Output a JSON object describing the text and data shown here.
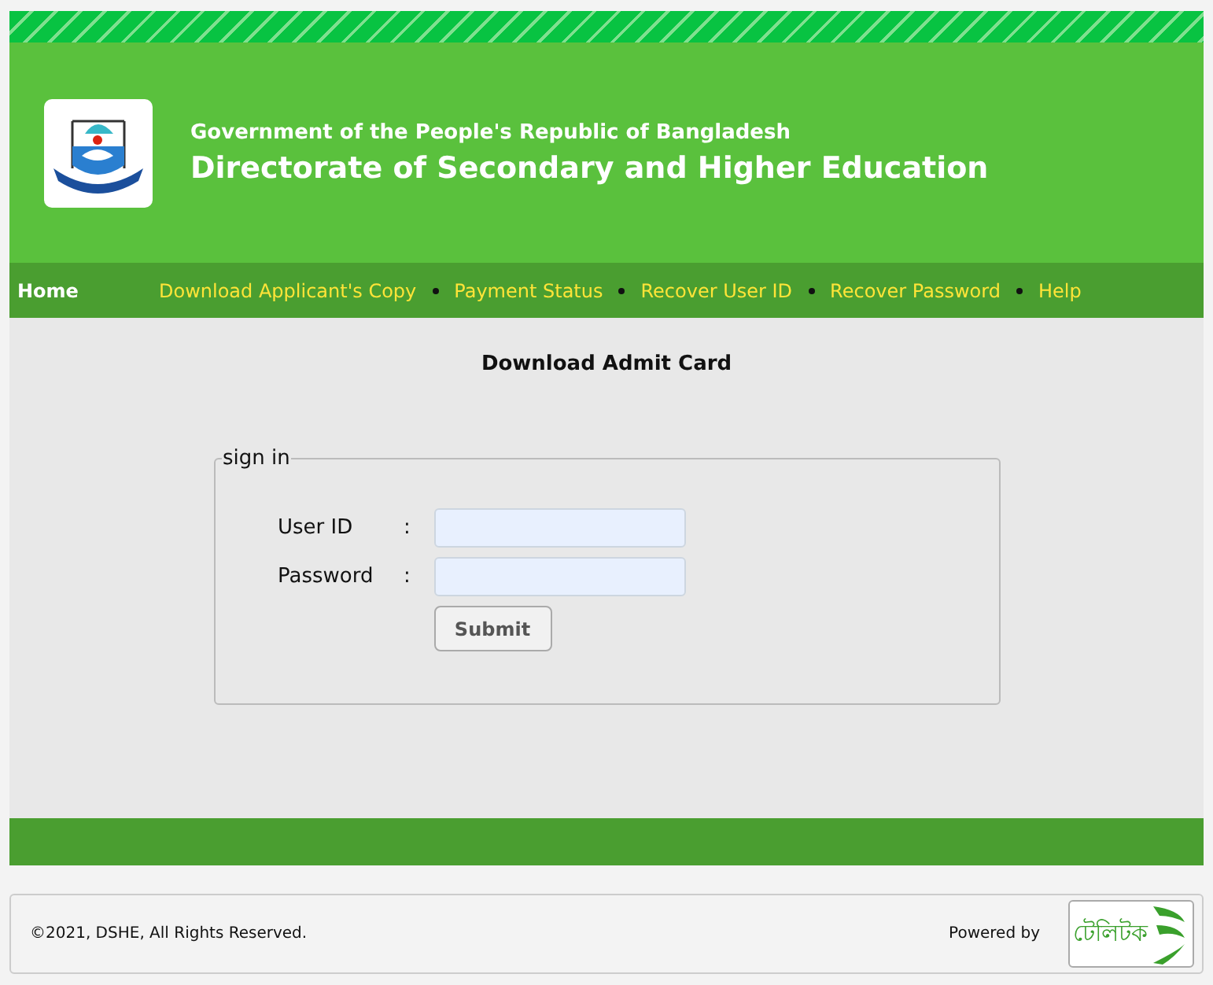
{
  "header": {
    "subtitle": "Government of the People's Republic of Bangladesh",
    "title": "Directorate of Secondary and Higher Education"
  },
  "nav": [
    {
      "label": "Home",
      "selected": true
    },
    {
      "label": "Download Applicant's Copy",
      "selected": false
    },
    {
      "label": "Payment Status",
      "selected": false
    },
    {
      "label": "Recover User ID",
      "selected": false
    },
    {
      "label": "Recover Password",
      "selected": false
    },
    {
      "label": "Help",
      "selected": false
    }
  ],
  "page_title": "Download Admit Card",
  "form": {
    "legend": "sign in",
    "fields": [
      {
        "label": "User ID",
        "separator": ":"
      },
      {
        "label": "Password",
        "separator": ":"
      }
    ],
    "submit": "Submit"
  },
  "footer": {
    "copyright": "©2021, DSHE, All Rights Reserved.",
    "powered_by": "Powered by",
    "brand": "টেলিটক"
  }
}
